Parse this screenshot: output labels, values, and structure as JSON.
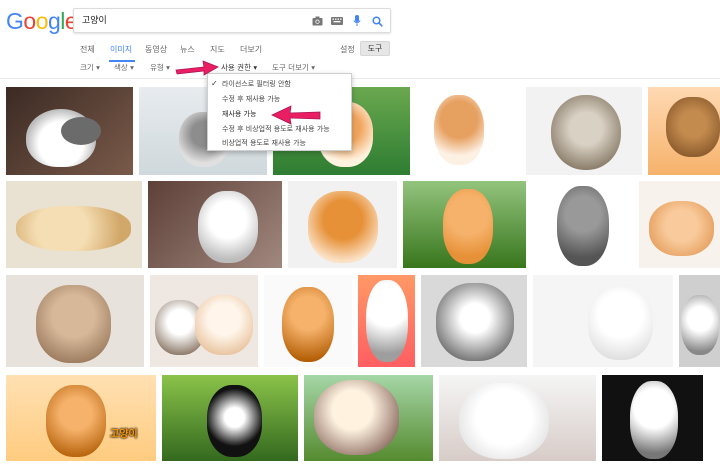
{
  "logo": {
    "text": "Google",
    "letters": [
      {
        "ch": "G",
        "color": "#4285F4"
      },
      {
        "ch": "o",
        "color": "#EA4335"
      },
      {
        "ch": "o",
        "color": "#FBBC05"
      },
      {
        "ch": "g",
        "color": "#4285F4"
      },
      {
        "ch": "l",
        "color": "#34A853"
      },
      {
        "ch": "e",
        "color": "#EA4335"
      }
    ]
  },
  "search": {
    "query": "고양이"
  },
  "icons": {
    "camera": "camera-icon",
    "keyboard": "keyboard-icon",
    "mic": "microphone-icon",
    "search": "search-icon"
  },
  "tabs": [
    "전체",
    "이미지",
    "동영상",
    "뉴스",
    "지도",
    "더보기"
  ],
  "active_tab": "이미지",
  "settings_label": "설정",
  "tools_label": "도구",
  "filters": [
    "크기 ▾",
    "색상 ▾",
    "유형 ▾",
    "사용 권한 ▾",
    "도구 더보기 ▾"
  ],
  "dropdown": {
    "items": [
      "라이선스로 필터링 안함",
      "수정 후 재사용 가능",
      "재사용 가능",
      "수정 후 비상업적 용도로 재사용 가능",
      "비상업적 용도로 재사용 가능"
    ],
    "checked_index": 0
  },
  "image_overlay_text": {
    "line1": "고양이"
  },
  "colors": {
    "accent": "#4285f4",
    "arrow": "#e91e63"
  }
}
